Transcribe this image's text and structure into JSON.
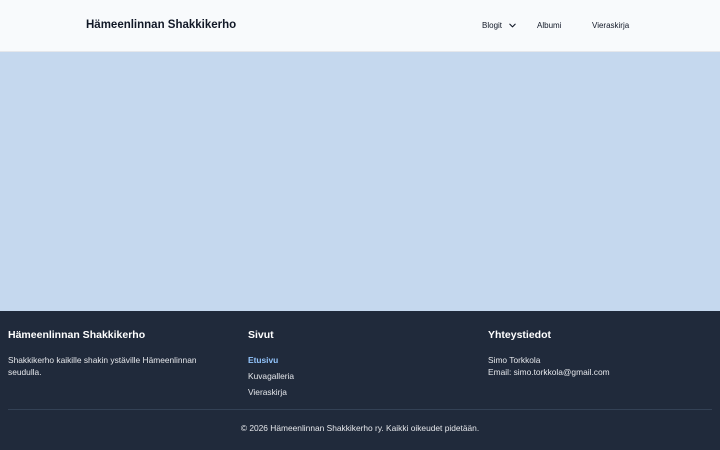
{
  "header": {
    "brand": "Hämeenlinnan Shakkikerho",
    "nav": {
      "blogit": "Blogit",
      "albumi": "Albumi",
      "vieraskirja": "Vieraskirja"
    }
  },
  "colors": {
    "hero_bg": "#c5d8ee",
    "footer_bg": "#202a3b",
    "active_link": "#93c5fd"
  },
  "footer": {
    "about": {
      "title": "Hämeenlinnan Shakkikerho",
      "text": "Shakkikerho kaikille shakin ystäville Hämeenlinnan seudulla."
    },
    "pages": {
      "title": "Sivut",
      "links": [
        "Etusivu",
        "Kuvagalleria",
        "Vieraskirja"
      ]
    },
    "contact": {
      "title": "Yhteystiedot",
      "name": "Simo Torkkola",
      "email": "Email: simo.torkkola@gmail.com"
    },
    "copyright": "© 2026 Hämeenlinnan Shakkikerho ry. Kaikki oikeudet pidetään."
  }
}
